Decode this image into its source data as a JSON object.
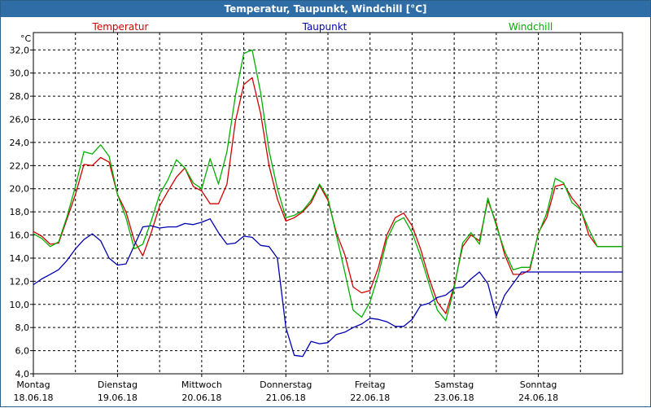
{
  "window": {
    "title": "Temperatur, Taupunkt, Windchill [°C]"
  },
  "chart_data": {
    "type": "line",
    "title": "Temperatur, Taupunkt, Windchill [°C]",
    "ylabel": "°C",
    "ylim": [
      4.0,
      33.5
    ],
    "xlim": [
      0,
      7.0
    ],
    "grid": true,
    "legend_placement": "top",
    "yticks": [
      "4,0",
      "6,0",
      "8,0",
      "10,0",
      "12,0",
      "14,0",
      "16,0",
      "18,0",
      "20,0",
      "22,0",
      "24,0",
      "26,0",
      "28,0",
      "30,0",
      "32,0"
    ],
    "x_categories": [
      {
        "day": "Montag",
        "date": "18.06.18"
      },
      {
        "day": "Dienstag",
        "date": "19.06.18"
      },
      {
        "day": "Mittwoch",
        "date": "20.06.18"
      },
      {
        "day": "Donnerstag",
        "date": "21.06.18"
      },
      {
        "day": "Freitag",
        "date": "22.06.18"
      },
      {
        "day": "Samstag",
        "date": "23.06.18"
      },
      {
        "day": "Sonntag",
        "date": "24.06.18"
      }
    ],
    "series": [
      {
        "name": "Temperatur",
        "color": "#d00000",
        "x": [
          0.0,
          0.1,
          0.2,
          0.3,
          0.4,
          0.5,
          0.6,
          0.7,
          0.8,
          0.9,
          1.0,
          1.1,
          1.2,
          1.3,
          1.4,
          1.5,
          1.6,
          1.7,
          1.8,
          1.9,
          2.0,
          2.1,
          2.2,
          2.3,
          2.4,
          2.5,
          2.6,
          2.7,
          2.8,
          2.9,
          3.0,
          3.1,
          3.2,
          3.3,
          3.4,
          3.5,
          3.6,
          3.7,
          3.8,
          3.9,
          4.0,
          4.1,
          4.2,
          4.3,
          4.4,
          4.5,
          4.6,
          4.7,
          4.8,
          4.9,
          5.0,
          5.1,
          5.2,
          5.3,
          5.4,
          5.5,
          5.6,
          5.7,
          5.8,
          5.9,
          6.0,
          6.1,
          6.2,
          6.3,
          6.4,
          6.5,
          6.6,
          6.7,
          6.8,
          6.9,
          7.0
        ],
        "y": [
          16.3,
          15.9,
          15.2,
          15.3,
          17.4,
          19.5,
          22.1,
          22.0,
          22.7,
          22.3,
          19.5,
          18.0,
          15.5,
          14.2,
          16.2,
          18.5,
          19.8,
          21.0,
          21.8,
          20.2,
          19.8,
          18.7,
          18.7,
          20.4,
          25.8,
          29.0,
          29.6,
          26.5,
          22.0,
          19.1,
          17.2,
          17.5,
          18.0,
          18.8,
          20.3,
          19.0,
          16.2,
          14.3,
          11.5,
          11.0,
          11.2,
          13.2,
          16.0,
          17.5,
          17.9,
          16.8,
          14.8,
          12.3,
          10.2,
          9.2,
          11.6,
          15.0,
          16.0,
          15.5,
          19.0,
          17.0,
          14.3,
          12.6,
          12.6,
          13.0,
          16.2,
          17.5,
          20.2,
          20.4,
          19.2,
          18.3,
          16.0,
          15.0,
          15.0,
          15.0,
          15.0
        ]
      },
      {
        "name": "Taupunkt",
        "color": "#0000b0",
        "x": [
          0.0,
          0.1,
          0.2,
          0.3,
          0.4,
          0.5,
          0.6,
          0.7,
          0.8,
          0.9,
          1.0,
          1.1,
          1.2,
          1.3,
          1.4,
          1.5,
          1.6,
          1.7,
          1.8,
          1.9,
          2.0,
          2.1,
          2.2,
          2.3,
          2.4,
          2.5,
          2.6,
          2.7,
          2.8,
          2.9,
          3.0,
          3.1,
          3.2,
          3.3,
          3.4,
          3.5,
          3.6,
          3.7,
          3.8,
          3.9,
          4.0,
          4.1,
          4.2,
          4.3,
          4.4,
          4.5,
          4.6,
          4.7,
          4.8,
          4.9,
          5.0,
          5.1,
          5.2,
          5.3,
          5.4,
          5.5,
          5.6,
          5.7,
          5.8,
          5.9,
          6.0,
          6.1,
          6.2,
          6.3,
          6.4,
          6.5,
          6.6,
          6.7,
          6.8,
          6.9,
          7.0
        ],
        "y": [
          11.7,
          12.2,
          12.6,
          13.0,
          13.8,
          14.8,
          15.6,
          16.1,
          15.5,
          14.0,
          13.4,
          13.5,
          15.1,
          16.7,
          16.8,
          16.6,
          16.7,
          16.7,
          17.0,
          16.9,
          17.1,
          17.4,
          16.2,
          15.2,
          15.3,
          15.9,
          15.8,
          15.1,
          15.0,
          14.0,
          8.0,
          5.6,
          5.5,
          6.8,
          6.6,
          6.7,
          7.4,
          7.6,
          8.0,
          8.3,
          8.8,
          8.7,
          8.5,
          8.1,
          8.1,
          8.7,
          9.9,
          10.1,
          10.6,
          10.8,
          11.4,
          11.5,
          12.2,
          12.8,
          11.8,
          9.0,
          10.8,
          11.8,
          12.8,
          12.8,
          12.8,
          12.8,
          12.8,
          12.8,
          12.8,
          12.8,
          12.8,
          12.8,
          12.8,
          12.8,
          12.8
        ]
      },
      {
        "name": "Windchill",
        "color": "#00b000",
        "x": [
          0.0,
          0.1,
          0.2,
          0.3,
          0.4,
          0.5,
          0.6,
          0.7,
          0.8,
          0.9,
          1.0,
          1.1,
          1.2,
          1.3,
          1.4,
          1.5,
          1.6,
          1.7,
          1.8,
          1.9,
          2.0,
          2.1,
          2.2,
          2.3,
          2.4,
          2.5,
          2.6,
          2.7,
          2.8,
          2.9,
          3.0,
          3.1,
          3.2,
          3.3,
          3.4,
          3.5,
          3.6,
          3.7,
          3.8,
          3.9,
          4.0,
          4.1,
          4.2,
          4.3,
          4.4,
          4.5,
          4.6,
          4.7,
          4.8,
          4.9,
          5.0,
          5.1,
          5.2,
          5.3,
          5.4,
          5.5,
          5.6,
          5.7,
          5.8,
          5.9,
          6.0,
          6.1,
          6.2,
          6.3,
          6.4,
          6.5,
          6.6,
          6.7,
          6.8,
          6.9,
          7.0
        ],
        "y": [
          16.1,
          15.7,
          15.0,
          15.4,
          17.6,
          20.2,
          23.2,
          23.0,
          23.8,
          22.8,
          19.5,
          17.5,
          14.8,
          15.2,
          17.2,
          19.5,
          20.8,
          22.5,
          21.8,
          20.5,
          20.0,
          22.6,
          20.4,
          23.2,
          28.0,
          31.7,
          32.0,
          28.3,
          23.3,
          20.0,
          17.5,
          17.7,
          18.1,
          19.0,
          20.4,
          19.2,
          16.0,
          12.8,
          9.5,
          8.9,
          10.2,
          12.6,
          15.6,
          17.1,
          17.5,
          16.2,
          14.2,
          11.8,
          9.5,
          8.6,
          11.4,
          15.3,
          16.2,
          15.2,
          19.2,
          16.8,
          14.6,
          13.0,
          13.2,
          13.2,
          16.1,
          17.9,
          20.9,
          20.5,
          18.8,
          18.2,
          16.5,
          15.0,
          15.0,
          15.0,
          15.0
        ]
      }
    ]
  }
}
